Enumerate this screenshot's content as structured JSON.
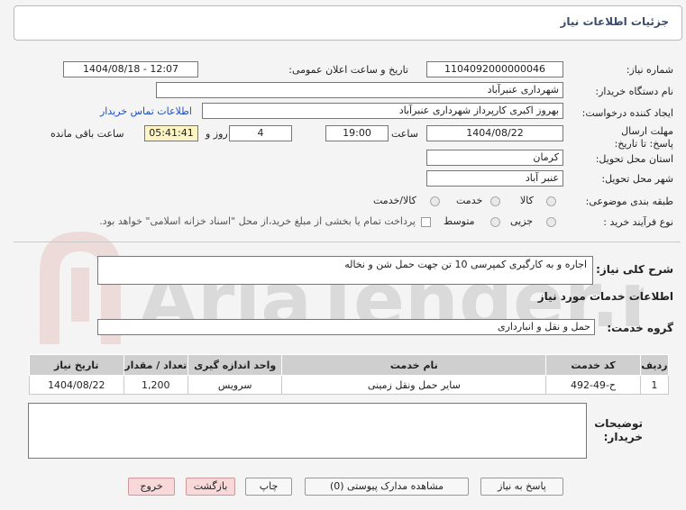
{
  "header": {
    "title": "جزئیات اطلاعات نیاز"
  },
  "fields": {
    "need_number_label": "شماره نیاز:",
    "need_number": "1104092000000046",
    "announce_label": "تاریخ و ساعت اعلان عمومی:",
    "announce_value": "1404/08/18 - 12:07",
    "buyer_org_label": "نام دستگاه خریدار:",
    "buyer_org": "شهرداری عنبرآباد",
    "requester_label": "ایجاد کننده درخواست:",
    "requester": "بهروز اکبری کارپرداز شهرداری عنبرآباد",
    "contact_link": "اطلاعات تماس خریدار",
    "deadline_label": "مهلت ارسال پاسخ: تا تاریخ:",
    "deadline_date": "1404/08/22",
    "time_label": "ساعت",
    "deadline_time": "19:00",
    "days": "4",
    "days_label": "روز و",
    "remaining": "05:41:41",
    "remaining_label": "ساعت باقی مانده",
    "province_label": "استان محل تحویل:",
    "province": "کرمان",
    "city_label": "شهر محل تحویل:",
    "city": "عنبر آباد",
    "category_label": "طبقه بندی موضوعی:",
    "category_options": [
      "کالا",
      "خدمت",
      "کالا/خدمت"
    ],
    "purchase_type_label": "نوع فرآیند خرید :",
    "purchase_options": [
      "جزیی",
      "متوسط"
    ],
    "payment_note": "پرداخت تمام یا بخشی از مبلغ خرید،از محل \"اسناد خزانه اسلامی\" خواهد بود."
  },
  "description": {
    "label": "شرح کلی نیاز:",
    "value": "اجاره و به کارگیری کمپرسی 10 تن جهت حمل شن و نخاله"
  },
  "services_info_title": "اطلاعات خدمات مورد نیاز",
  "service_group": {
    "label": "گروه خدمت:",
    "value": "حمل و نقل و انبارداری"
  },
  "table": {
    "headers": [
      "ردیف",
      "کد خدمت",
      "نام خدمت",
      "واحد اندازه گیری",
      "تعداد / مقدار",
      "تاریخ نیاز"
    ],
    "rows": [
      [
        "1",
        "ح-49-492",
        "سایر حمل ونقل زمینی",
        "سرویس",
        "1,200",
        "1404/08/22"
      ]
    ]
  },
  "buyer_notes": {
    "label": "توضیحات خریدار:",
    "value": ""
  },
  "buttons": {
    "reply": "پاسخ به نیاز",
    "attachments": "مشاهده مدارک پیوستی (0)",
    "print": "چاپ",
    "back": "بازگشت",
    "exit": "خروج"
  },
  "watermark": "AriaTender.net"
}
